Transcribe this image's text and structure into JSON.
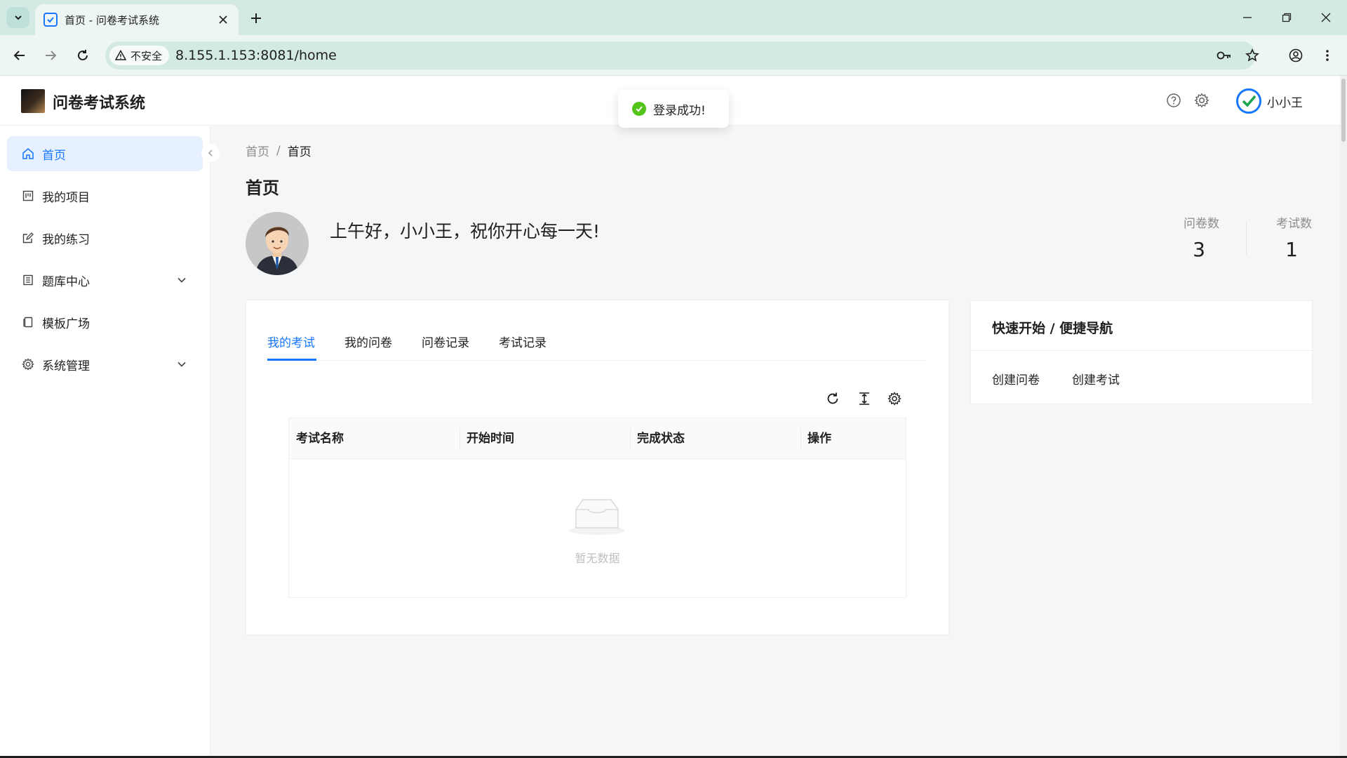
{
  "browser": {
    "tab_title": "首页 - 问卷考试系统",
    "security_label": "不安全",
    "url": "8.155.1.153:8081/home"
  },
  "app": {
    "title": "问卷考试系统",
    "user_name": "小小王",
    "toast": "登录成功!",
    "accent_color": "#1677ff",
    "success_color": "#52c41a"
  },
  "sidebar": {
    "items": [
      {
        "label": "首页",
        "icon": "home-icon",
        "active": true
      },
      {
        "label": "我的项目",
        "icon": "project-icon"
      },
      {
        "label": "我的练习",
        "icon": "edit-icon"
      },
      {
        "label": "题库中心",
        "icon": "book-icon",
        "expandable": true
      },
      {
        "label": "模板广场",
        "icon": "template-icon"
      },
      {
        "label": "系统管理",
        "icon": "gear-icon",
        "expandable": true
      }
    ]
  },
  "breadcrumb": {
    "root": "首页",
    "separator": "/",
    "current": "首页"
  },
  "page": {
    "title": "首页",
    "greeting": "上午好，小小王，祝你开心每一天!",
    "stats": [
      {
        "label": "问卷数",
        "value": "3"
      },
      {
        "label": "考试数",
        "value": "1"
      }
    ]
  },
  "tabs": [
    {
      "label": "我的考试",
      "active": true
    },
    {
      "label": "我的问卷"
    },
    {
      "label": "问卷记录"
    },
    {
      "label": "考试记录"
    }
  ],
  "table": {
    "columns": [
      "考试名称",
      "开始时间",
      "完成状态",
      "操作"
    ],
    "rows": [],
    "empty_text": "暂无数据"
  },
  "quick_nav": {
    "title": "快速开始 / 便捷导航",
    "links": [
      "创建问卷",
      "创建考试"
    ]
  }
}
